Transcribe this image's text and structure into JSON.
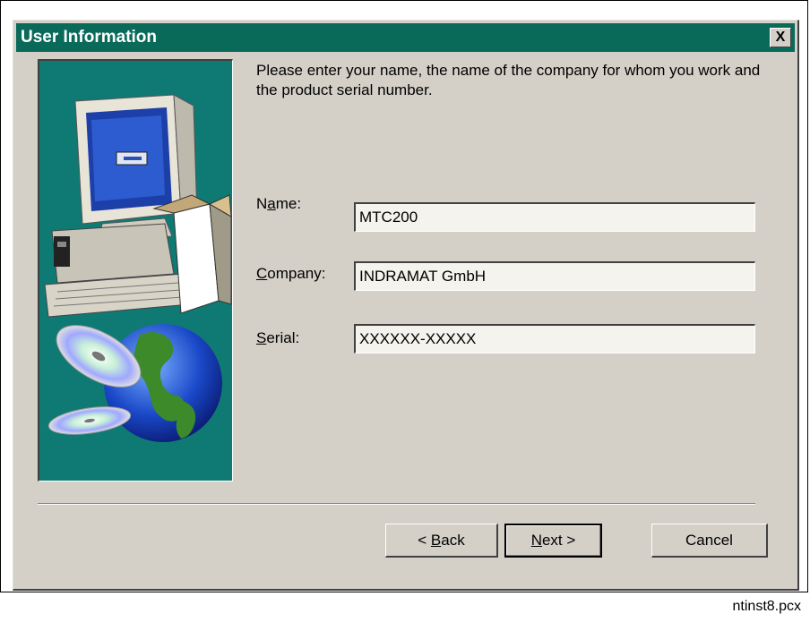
{
  "dialog": {
    "title": "User Information",
    "close_label": "X",
    "intro": "Please enter your name, the name of the company for whom you work and the product serial number.",
    "fields": [
      {
        "label_pre": "N",
        "label_key": "a",
        "label_post": "me:",
        "value": "MTC200"
      },
      {
        "label_pre": "",
        "label_key": "C",
        "label_post": "ompany:",
        "value": "INDRAMAT GmbH"
      },
      {
        "label_pre": "",
        "label_key": "S",
        "label_post": "erial:",
        "value": "XXXXXX-XXXXX"
      }
    ],
    "buttons": {
      "back": {
        "arrow": "< ",
        "key": "B",
        "rest": "ack"
      },
      "next": {
        "key": "N",
        "rest": "ext >"
      },
      "cancel": "Cancel"
    }
  },
  "caption": "ntinst8.pcx",
  "colors": {
    "title_bar": "#0a6a5a",
    "illustration_bg": "#0f7a73",
    "dialog_bg": "#d4d0c8"
  }
}
